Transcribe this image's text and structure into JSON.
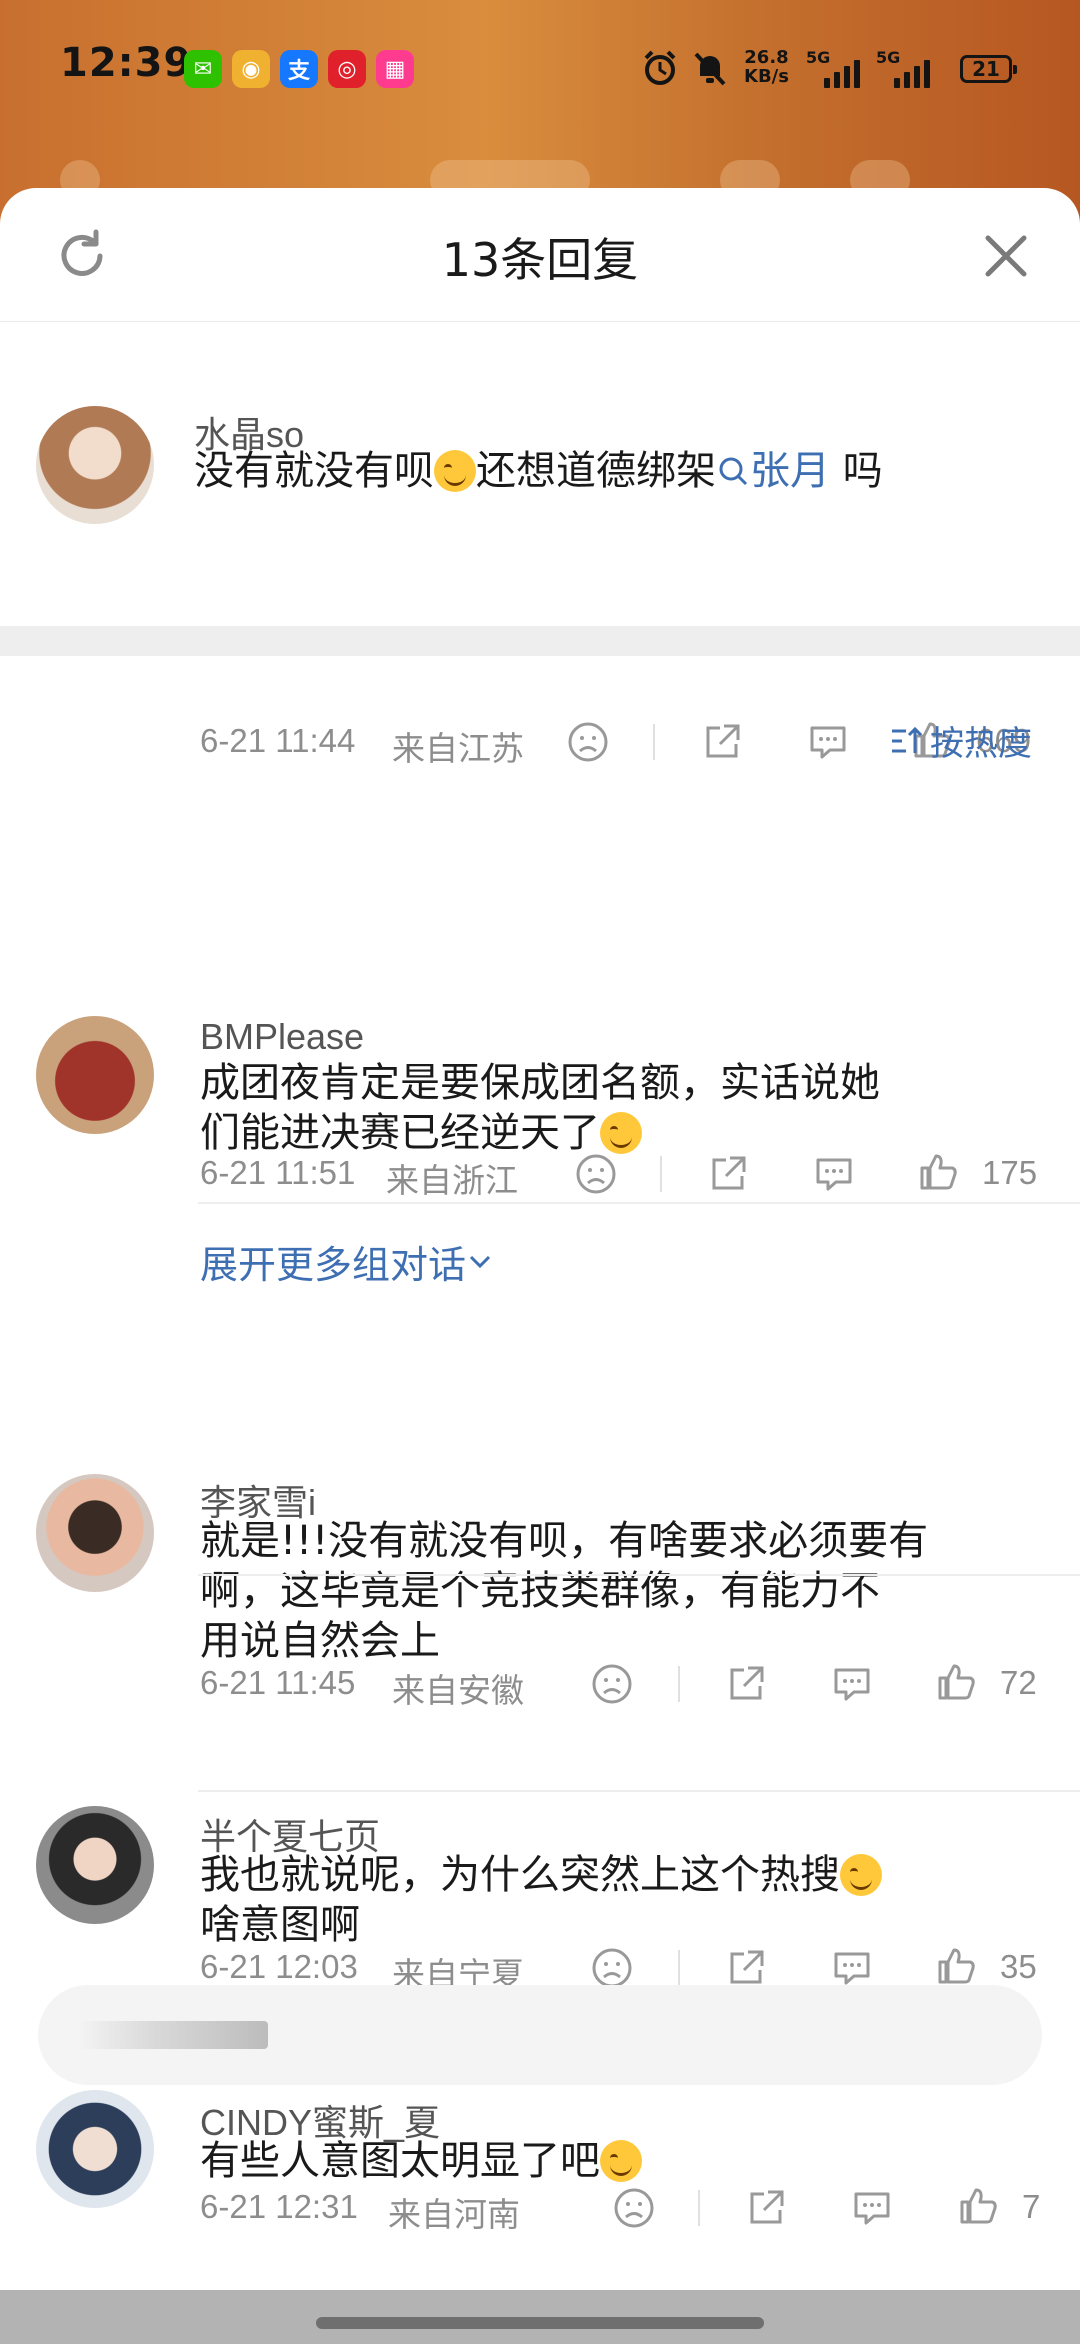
{
  "status_bar": {
    "time": "12:39",
    "app_icons": [
      {
        "name": "wechat-icon",
        "glyph": "✉",
        "color": "#2dc100"
      },
      {
        "name": "weibo-icon",
        "glyph": "◉",
        "color": "#f0b030"
      },
      {
        "name": "alipay-icon",
        "glyph": "支",
        "color": "#1677ff"
      },
      {
        "name": "netease-music-icon",
        "glyph": "◎",
        "color": "#e0202a"
      },
      {
        "name": "app-icon-pink",
        "glyph": "▦",
        "color": "#ff3b8f"
      }
    ],
    "net_speed": "26.8",
    "net_unit": "KB/s",
    "sig1": "5G",
    "sig2": "5G",
    "battery": "21"
  },
  "sheet": {
    "title": "13条回复",
    "sort_label": "按热度"
  },
  "main_comment": {
    "user": "水晶so",
    "text_before": "没有就没有呗",
    "text_mid": "还想道德绑架",
    "mention": "张月",
    "text_after": " 吗",
    "date": "6-21 11:44",
    "location": "来自江苏",
    "likes": "669"
  },
  "replies": [
    {
      "user": "BMPlease",
      "text_lines": [
        "成团夜肯定是要保成团名额，实话说她",
        "们能进决赛已经逆天了"
      ],
      "emoji_end": true,
      "date": "6-21 11:51",
      "location": "来自浙江",
      "likes": "175",
      "expand": "展开更多组对话"
    },
    {
      "user": "李家雪i",
      "text_lines": [
        "就是!!!没有就没有呗，有啥要求必须要有",
        "啊，这毕竟是个竞技类群像，有能力不",
        "用说自然会上"
      ],
      "emoji_end": false,
      "date": "6-21 11:45",
      "location": "来自安徽",
      "likes": "72"
    },
    {
      "user": "半个夏七页",
      "text_lines": [
        "我也就说呢，为什么突然上这个热搜",
        "啥意图啊"
      ],
      "emoji_line1": true,
      "date": "6-21 12:03",
      "location": "来自宁夏",
      "likes": "35"
    },
    {
      "user": "CINDY蜜斯_夏",
      "text_lines": [
        "有些人意图太明显了吧"
      ],
      "emoji_end": true,
      "date": "6-21 12:31",
      "location": "来自河南",
      "likes": "7"
    }
  ]
}
